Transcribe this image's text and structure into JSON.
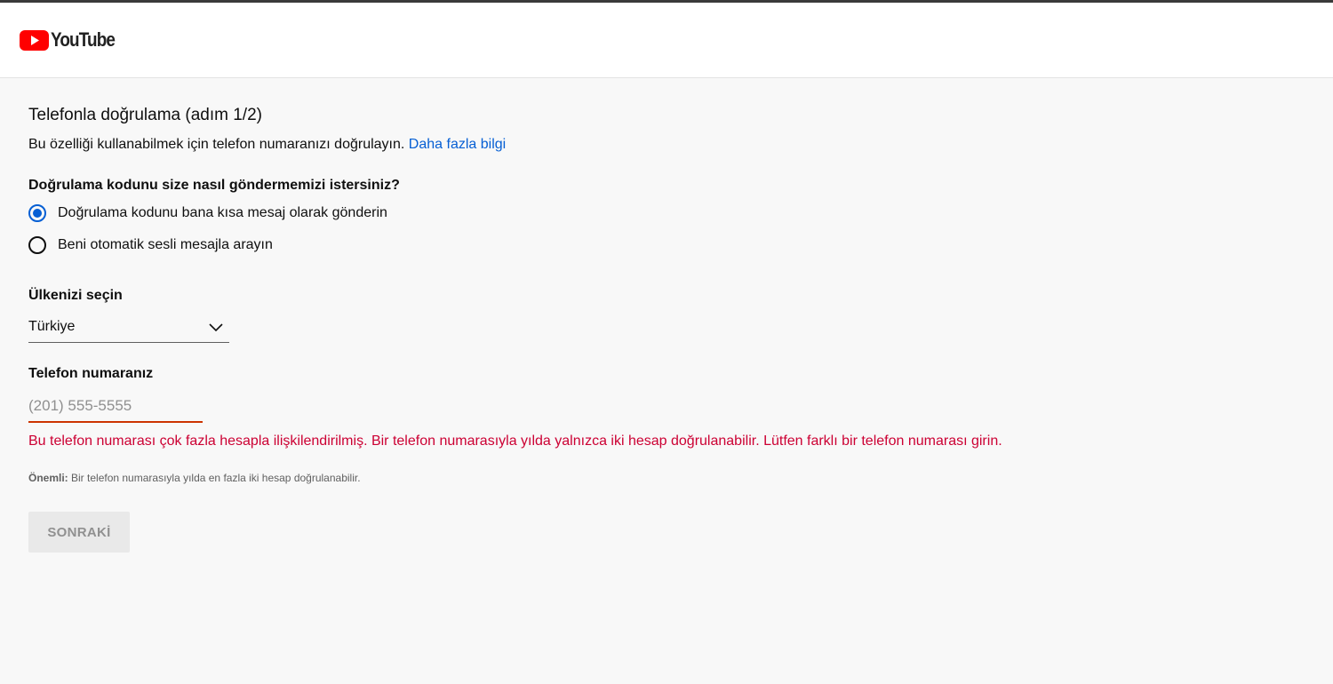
{
  "header": {
    "logo_text": "YouTube",
    "logo_icon": "youtube-play-icon",
    "brand_color": "#ff0000"
  },
  "main": {
    "title": "Telefonla doğrulama (adım 1/2)",
    "intro_text": "Bu özelliği kullanabilmek için telefon numaranızı doğrulayın.",
    "learn_more_link": "Daha fazla bilgi",
    "delivery_question": "Doğrulama kodunu size nasıl göndermemizi istersiniz?",
    "delivery_options": [
      {
        "label": "Doğrulama kodunu bana kısa mesaj olarak gönderin",
        "selected": true
      },
      {
        "label": "Beni otomatik sesli mesajla arayın",
        "selected": false
      }
    ],
    "country_label": "Ülkenizi seçin",
    "country_value": "Türkiye",
    "phone_label": "Telefon numaranız",
    "phone_value": "",
    "phone_placeholder": "(201) 555-5555",
    "error_message": "Bu telefon numarası çok fazla hesapla ilişkilendirilmiş. Bir telefon numarasıyla yılda yalnızca iki hesap doğrulanabilir. Lütfen farklı bir telefon numarası girin.",
    "note_label": "Önemli:",
    "note_text": "Bir telefon numarasıyla yılda en fazla iki hesap doğrulanabilir.",
    "next_button": "SONRAKİ"
  },
  "colors": {
    "accent": "#065fd4",
    "error": "#cc0033",
    "input_underline_error": "#cc3300",
    "disabled_button_bg": "#e9e9e9"
  }
}
